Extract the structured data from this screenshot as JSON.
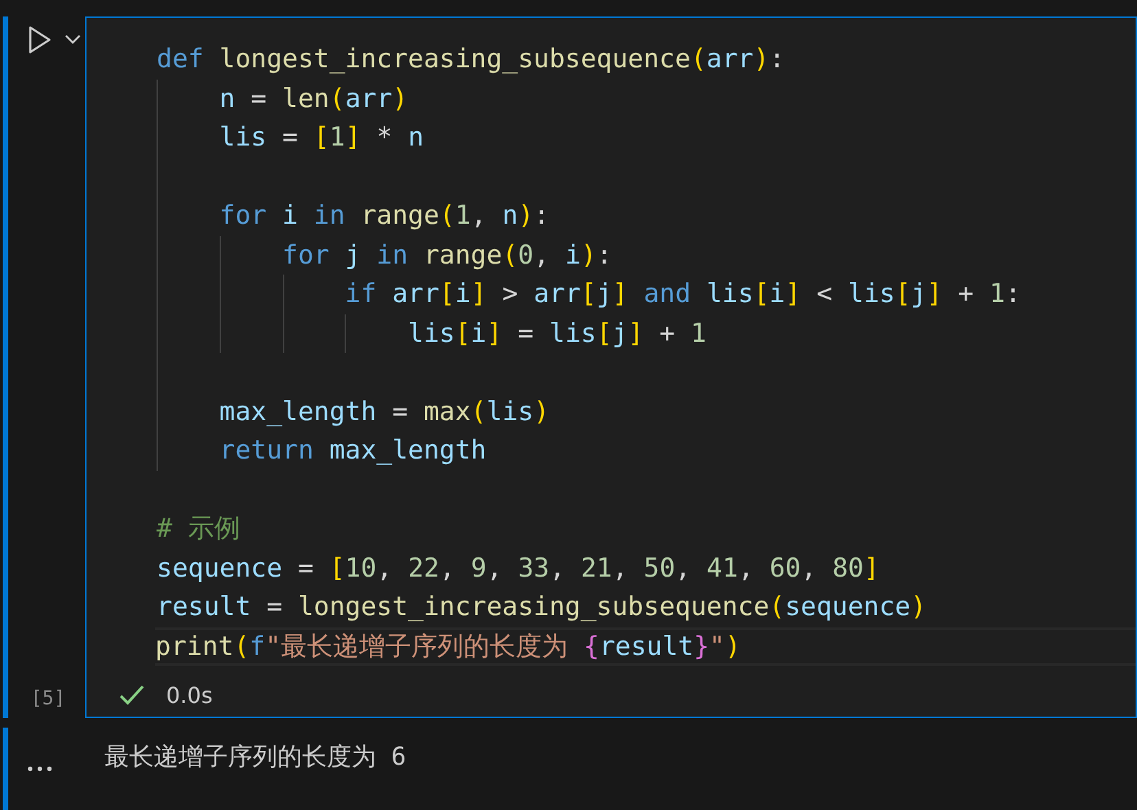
{
  "cell": {
    "execution_count": "[5]",
    "succeeded": true,
    "duration": "0.0s",
    "lines": [
      {
        "kind": "code",
        "current": false,
        "tokens": [
          {
            "kind": "kw",
            "text": "def "
          },
          {
            "kind": "fn",
            "text": "longest_increasing_subsequence"
          },
          {
            "kind": "b1",
            "text": "("
          },
          {
            "kind": "var",
            "text": "arr"
          },
          {
            "kind": "b1",
            "text": ")"
          },
          {
            "kind": "p",
            "text": ":"
          }
        ],
        "children": [
          {
            "kind": "code",
            "current": false,
            "tokens": [
              {
                "kind": "var",
                "text": "n"
              },
              {
                "kind": "p",
                "text": " = "
              },
              {
                "kind": "fn",
                "text": "len"
              },
              {
                "kind": "b1",
                "text": "("
              },
              {
                "kind": "var",
                "text": "arr"
              },
              {
                "kind": "b1",
                "text": ")"
              }
            ]
          },
          {
            "kind": "code",
            "current": false,
            "tokens": [
              {
                "kind": "var",
                "text": "lis"
              },
              {
                "kind": "p",
                "text": " = "
              },
              {
                "kind": "b1",
                "text": "["
              },
              {
                "kind": "num",
                "text": "1"
              },
              {
                "kind": "b1",
                "text": "]"
              },
              {
                "kind": "p",
                "text": " * "
              },
              {
                "kind": "var",
                "text": "n"
              }
            ]
          },
          {
            "kind": "blank",
            "current": false
          },
          {
            "kind": "code",
            "current": false,
            "tokens": [
              {
                "kind": "kw",
                "text": "for "
              },
              {
                "kind": "var",
                "text": "i "
              },
              {
                "kind": "kw",
                "text": "in "
              },
              {
                "kind": "fn",
                "text": "range"
              },
              {
                "kind": "b1",
                "text": "("
              },
              {
                "kind": "num",
                "text": "1"
              },
              {
                "kind": "p",
                "text": ", "
              },
              {
                "kind": "var",
                "text": "n"
              },
              {
                "kind": "b1",
                "text": ")"
              },
              {
                "kind": "p",
                "text": ":"
              }
            ],
            "children": [
              {
                "kind": "code",
                "current": false,
                "tokens": [
                  {
                    "kind": "kw",
                    "text": "for "
                  },
                  {
                    "kind": "var",
                    "text": "j "
                  },
                  {
                    "kind": "kw",
                    "text": "in "
                  },
                  {
                    "kind": "fn",
                    "text": "range"
                  },
                  {
                    "kind": "b1",
                    "text": "("
                  },
                  {
                    "kind": "num",
                    "text": "0"
                  },
                  {
                    "kind": "p",
                    "text": ", "
                  },
                  {
                    "kind": "var",
                    "text": "i"
                  },
                  {
                    "kind": "b1",
                    "text": ")"
                  },
                  {
                    "kind": "p",
                    "text": ":"
                  }
                ],
                "children": [
                  {
                    "kind": "code",
                    "current": false,
                    "tokens": [
                      {
                        "kind": "kw",
                        "text": "if "
                      },
                      {
                        "kind": "var",
                        "text": "arr"
                      },
                      {
                        "kind": "b1",
                        "text": "["
                      },
                      {
                        "kind": "var",
                        "text": "i"
                      },
                      {
                        "kind": "b1",
                        "text": "]"
                      },
                      {
                        "kind": "p",
                        "text": " > "
                      },
                      {
                        "kind": "var",
                        "text": "arr"
                      },
                      {
                        "kind": "b1",
                        "text": "["
                      },
                      {
                        "kind": "var",
                        "text": "j"
                      },
                      {
                        "kind": "b1",
                        "text": "]"
                      },
                      {
                        "kind": "kw",
                        "text": " and "
                      },
                      {
                        "kind": "var",
                        "text": "lis"
                      },
                      {
                        "kind": "b1",
                        "text": "["
                      },
                      {
                        "kind": "var",
                        "text": "i"
                      },
                      {
                        "kind": "b1",
                        "text": "]"
                      },
                      {
                        "kind": "p",
                        "text": " < "
                      },
                      {
                        "kind": "var",
                        "text": "lis"
                      },
                      {
                        "kind": "b1",
                        "text": "["
                      },
                      {
                        "kind": "var",
                        "text": "j"
                      },
                      {
                        "kind": "b1",
                        "text": "]"
                      },
                      {
                        "kind": "p",
                        "text": " + "
                      },
                      {
                        "kind": "num",
                        "text": "1"
                      },
                      {
                        "kind": "p",
                        "text": ":"
                      }
                    ],
                    "children": [
                      {
                        "kind": "code",
                        "current": false,
                        "tokens": [
                          {
                            "kind": "var",
                            "text": "lis"
                          },
                          {
                            "kind": "b1",
                            "text": "["
                          },
                          {
                            "kind": "var",
                            "text": "i"
                          },
                          {
                            "kind": "b1",
                            "text": "]"
                          },
                          {
                            "kind": "p",
                            "text": " = "
                          },
                          {
                            "kind": "var",
                            "text": "lis"
                          },
                          {
                            "kind": "b1",
                            "text": "["
                          },
                          {
                            "kind": "var",
                            "text": "j"
                          },
                          {
                            "kind": "b1",
                            "text": "]"
                          },
                          {
                            "kind": "p",
                            "text": " + "
                          },
                          {
                            "kind": "num",
                            "text": "1"
                          }
                        ]
                      }
                    ]
                  }
                ]
              }
            ]
          },
          {
            "kind": "blank",
            "current": false
          },
          {
            "kind": "code",
            "current": false,
            "tokens": [
              {
                "kind": "var",
                "text": "max_length"
              },
              {
                "kind": "p",
                "text": " = "
              },
              {
                "kind": "fn",
                "text": "max"
              },
              {
                "kind": "b1",
                "text": "("
              },
              {
                "kind": "var",
                "text": "lis"
              },
              {
                "kind": "b1",
                "text": ")"
              }
            ]
          },
          {
            "kind": "code",
            "current": false,
            "tokens": [
              {
                "kind": "kw",
                "text": "return "
              },
              {
                "kind": "var",
                "text": "max_length"
              }
            ]
          }
        ]
      },
      {
        "kind": "blank",
        "current": false
      },
      {
        "kind": "code",
        "current": false,
        "tokens": [
          {
            "kind": "comment",
            "text": "# 示例"
          }
        ]
      },
      {
        "kind": "code",
        "current": false,
        "tokens": [
          {
            "kind": "var",
            "text": "sequence"
          },
          {
            "kind": "p",
            "text": " = "
          },
          {
            "kind": "b1",
            "text": "["
          },
          {
            "kind": "num",
            "text": "10"
          },
          {
            "kind": "p",
            "text": ", "
          },
          {
            "kind": "num",
            "text": "22"
          },
          {
            "kind": "p",
            "text": ", "
          },
          {
            "kind": "num",
            "text": "9"
          },
          {
            "kind": "p",
            "text": ", "
          },
          {
            "kind": "num",
            "text": "33"
          },
          {
            "kind": "p",
            "text": ", "
          },
          {
            "kind": "num",
            "text": "21"
          },
          {
            "kind": "p",
            "text": ", "
          },
          {
            "kind": "num",
            "text": "50"
          },
          {
            "kind": "p",
            "text": ", "
          },
          {
            "kind": "num",
            "text": "41"
          },
          {
            "kind": "p",
            "text": ", "
          },
          {
            "kind": "num",
            "text": "60"
          },
          {
            "kind": "p",
            "text": ", "
          },
          {
            "kind": "num",
            "text": "80"
          },
          {
            "kind": "b1",
            "text": "]"
          }
        ]
      },
      {
        "kind": "code",
        "current": false,
        "tokens": [
          {
            "kind": "var",
            "text": "result"
          },
          {
            "kind": "p",
            "text": " = "
          },
          {
            "kind": "fn",
            "text": "longest_increasing_subsequence"
          },
          {
            "kind": "b1",
            "text": "("
          },
          {
            "kind": "var",
            "text": "sequence"
          },
          {
            "kind": "b1",
            "text": ")"
          }
        ]
      },
      {
        "kind": "code",
        "current": true,
        "tokens": [
          {
            "kind": "fn",
            "text": "print"
          },
          {
            "kind": "b1",
            "text": "("
          },
          {
            "kind": "kw",
            "text": "f"
          },
          {
            "kind": "str",
            "text": "\"最长递增子序列的长度为 "
          },
          {
            "kind": "b2",
            "text": "{"
          },
          {
            "kind": "var",
            "text": "result"
          },
          {
            "kind": "b2",
            "text": "}"
          },
          {
            "kind": "str",
            "text": "\""
          },
          {
            "kind": "b1",
            "text": ")"
          }
        ]
      }
    ]
  },
  "output": {
    "text": "最长递增子序列的长度为 6"
  }
}
